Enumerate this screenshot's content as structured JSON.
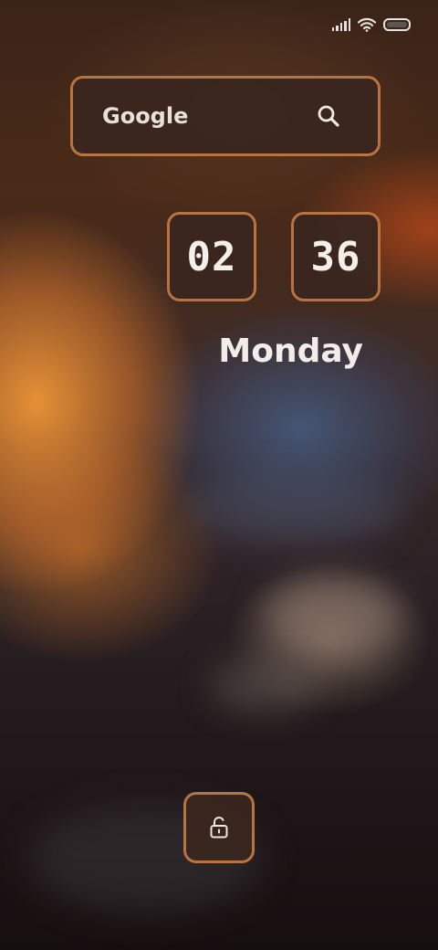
{
  "status_bar": {
    "icons": [
      "signal-icon",
      "wifi-icon",
      "battery-icon"
    ]
  },
  "search": {
    "label": "Google",
    "icon": "search-icon"
  },
  "clock": {
    "hours": "02",
    "minutes": "36",
    "day": "Monday"
  },
  "unlock": {
    "icon": "unlock-icon"
  },
  "colors": {
    "panel_border": "#b8733f",
    "panel_fill": "#3a261e",
    "text": "#f2ede8"
  }
}
